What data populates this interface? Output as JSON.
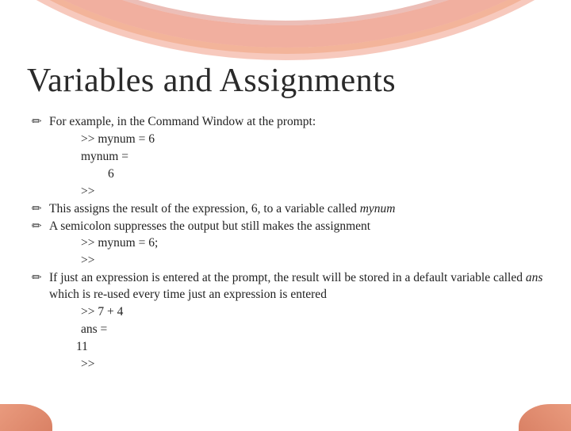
{
  "title": "Variables and Assignments",
  "bullets": {
    "b1": "For example, in the Command Window at the prompt:",
    "c1a": ">> mynum = 6",
    "c1b": "mynum =",
    "c1c": "6",
    "c1d": ">>",
    "b2_pre": "This assigns the result of the expression, 6, to a variable called ",
    "b2_var": "mynum",
    "b3": "A semicolon suppresses the output but still makes the assignment",
    "c3a": ">> mynum = 6;",
    "c3b": ">>",
    "b4_pre": "If just an expression is entered at the prompt, the result will be stored in a default variable called ",
    "b4_var": "ans",
    "b4_post": " which is re-used every time just an expression is entered",
    "c4a": ">> 7 + 4",
    "c4b": "ans =",
    "c4c": "11",
    "c4d": ">>"
  }
}
